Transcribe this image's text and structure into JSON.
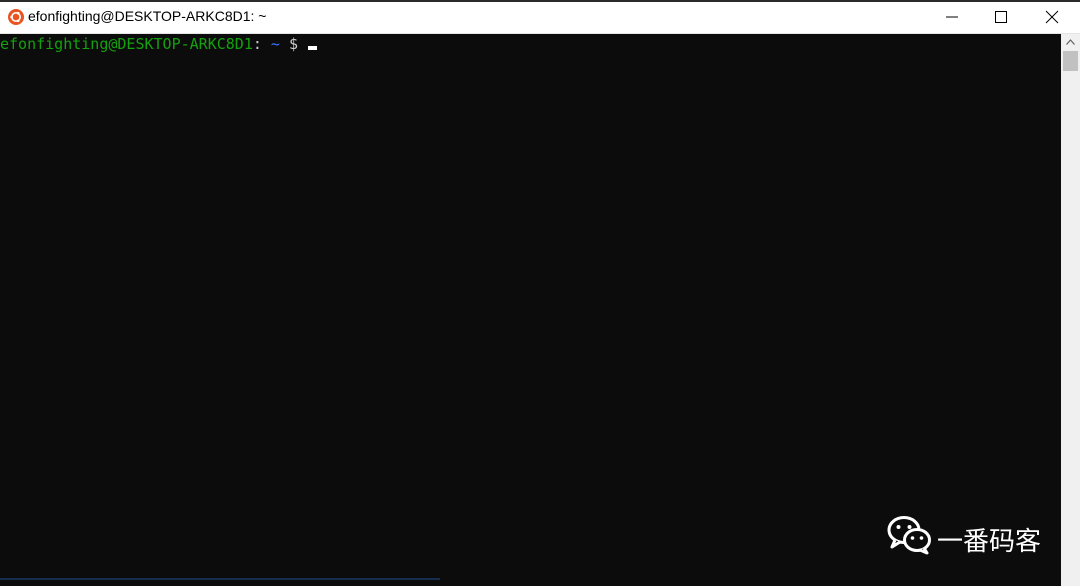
{
  "window": {
    "title": "efonfighting@DESKTOP-ARKC8D1: ~",
    "app_icon": "ubuntu-icon",
    "controls": {
      "minimize_icon": "minimize-icon",
      "maximize_icon": "maximize-icon",
      "close_icon": "close-icon"
    }
  },
  "terminal": {
    "prompt": {
      "user_host": "efonfighting@DESKTOP-ARKC8D1",
      "colon": ":",
      "path": " ~",
      "dollar": " $ "
    },
    "colors": {
      "background": "#0c0c0c",
      "user_host": "#13a10e",
      "path": "#3b78ff",
      "text": "#cccccc"
    }
  },
  "watermark": {
    "logo_icon": "wechat-icon",
    "text": "一番码客"
  }
}
